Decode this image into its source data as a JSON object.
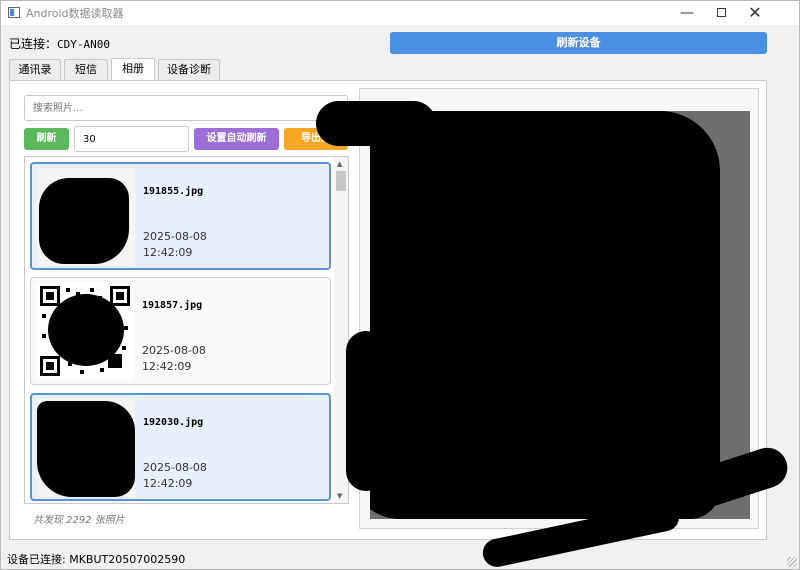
{
  "window": {
    "title": "Android数据读取器"
  },
  "connection": {
    "label": "已连接：",
    "device": "CDY-AN00"
  },
  "toolbar": {
    "refresh_device_label": "刷新设备"
  },
  "tabs": [
    {
      "label": "通讯录",
      "active": false
    },
    {
      "label": "短信",
      "active": false
    },
    {
      "label": "相册",
      "active": true
    },
    {
      "label": "设备诊断",
      "active": false
    }
  ],
  "gallery": {
    "search_placeholder": "搜索照片...",
    "refresh_label": "刷新",
    "interval_value": "30",
    "auto_refresh_label": "设置自动刷新",
    "export_label": "导出选",
    "items": [
      {
        "name": "191855.jpg",
        "date": "2025-08-08",
        "time": "12:42:09",
        "selected": true
      },
      {
        "name": "191857.jpg",
        "date": "2025-08-08",
        "time": "12:42:09",
        "selected": false
      },
      {
        "name": "192030.jpg",
        "date": "2025-08-08",
        "time": "12:42:09",
        "selected": true
      }
    ],
    "count_text": "共发现 2292 张照片"
  },
  "status": {
    "text": "设备已连接: MKBUT20507002590"
  },
  "colors": {
    "accent_blue": "#4a90e2",
    "refresh_green": "#5cb85c",
    "auto_purple": "#9b6fd6",
    "export_orange": "#f5a623",
    "selected_border": "#5b93cf"
  }
}
